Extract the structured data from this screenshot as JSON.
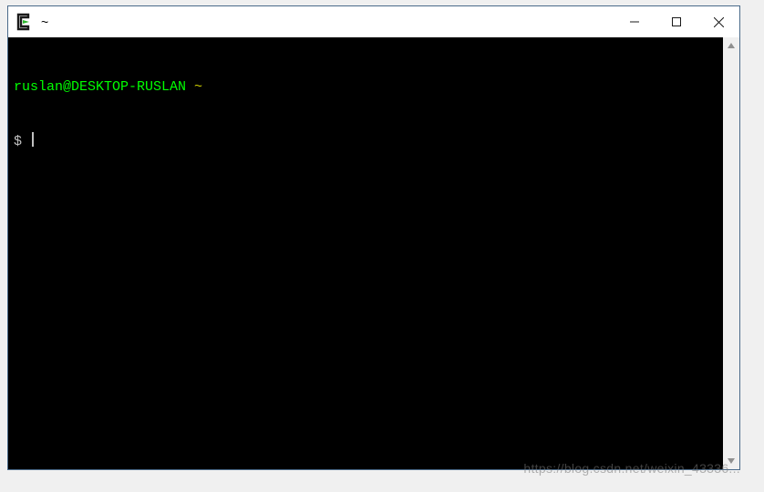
{
  "window": {
    "title": "~"
  },
  "terminal": {
    "prompt_user_host": "ruslan@DESKTOP-RUSLAN",
    "prompt_path": "~",
    "prompt_symbol": "$",
    "input": ""
  },
  "watermark": "https://blog.csdn.net/weixin_43336..."
}
